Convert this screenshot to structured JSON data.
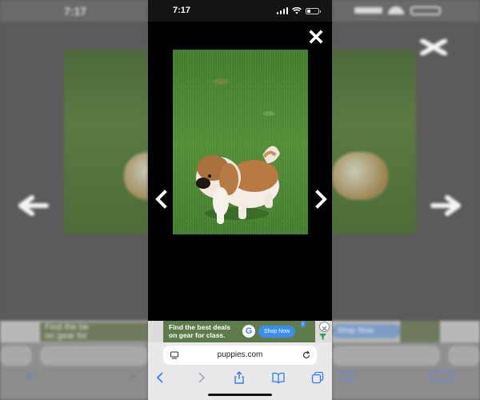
{
  "status_bar": {
    "time": "7:17"
  },
  "ad": {
    "line1": "Find the best deals",
    "line2": "on gear for class.",
    "cta": "Shop Now",
    "google_glyph": "G",
    "info_label": "i",
    "close_icon": "close-x-icon"
  },
  "address_bar": {
    "domain": "puppies.com",
    "reload_icon": "reload-icon",
    "page_icon": "page-menu-icon"
  },
  "toolbar": {
    "icons": [
      "back-icon",
      "forward-icon",
      "share-icon",
      "bookmarks-icon",
      "tabs-icon"
    ]
  },
  "gallery": {
    "close_icon": "close-x-icon",
    "prev_icon": "chevron-left-icon",
    "next_icon": "chevron-right-icon"
  },
  "colors": {
    "grass": "#4f8a36",
    "ad_bg": "#5f7b4a",
    "cta_blue": "#3b8df0",
    "toolbar_bg": "#e9e9eb"
  },
  "side_copies": {
    "time": "7:17",
    "ad_line1": "Find the be",
    "ad_line2": "on gear for",
    "ad_right": "Shop Now"
  }
}
